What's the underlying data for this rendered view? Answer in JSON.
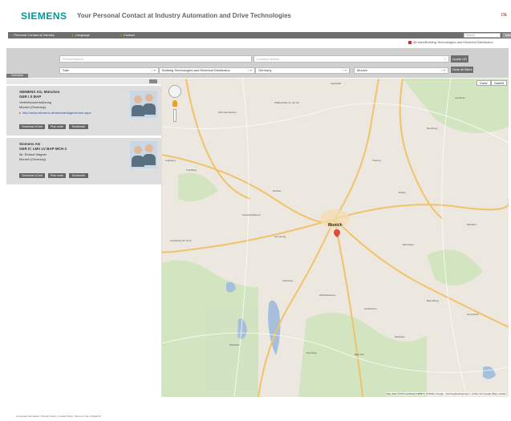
{
  "header": {
    "logo": "SIEMENS",
    "title": "Your Personal Contact at Industry Automation and Drive Technologies",
    "lang": "DE"
  },
  "nav": {
    "items": [
      "Personal Contact at Industry",
      "Language",
      "Contact"
    ],
    "search_placeholder": "Search",
    "search_button": "search"
  },
  "all_sites_label": "All sites/Building Technologies and Electrical Distribution",
  "filters": {
    "name_placeholder": "Person search",
    "location_placeholder": "Location search",
    "locate_button": "locate US",
    "clear_button": "Clear all filters",
    "selects": [
      "Sale",
      "Building Technologies and Electrical Distribution",
      "Germany",
      "Munich"
    ],
    "overview_tab": "Overview"
  },
  "results": [
    {
      "title": "SIEMENS AG, München",
      "dept": "GER I S BAP",
      "subtitle": "Vertriebsunterstützung",
      "city": "Munich (Germany)",
      "url": "http://www.siemens.de/alarmanlagen/index.aspx",
      "buttons": [
        "Download vCard",
        "Plan route",
        "Bookmark"
      ]
    },
    {
      "title": "Siemens AG",
      "dept": "GER IC LMV LV BAP MCH 3",
      "subtitle": "Mr. Roland Wagner",
      "city": "Munich (Germany)",
      "url": "",
      "buttons": [
        "Download vCard",
        "Plan route",
        "Bookmark"
      ]
    }
  ],
  "map": {
    "type_buttons": [
      "Karte",
      "Satellit"
    ],
    "city": "Munich",
    "labels": [
      "Schrobenhausen",
      "Pfaffenhofen an der Ilm",
      "Ingolstadt",
      "Landshut",
      "Freising",
      "Moosburg",
      "Augsburg",
      "Friedberg",
      "Dachau",
      "Erding",
      "Fürstenfeldbruck",
      "Germering",
      "Starnberg",
      "Wolfratshausen",
      "Rosenheim",
      "Holzkirchen",
      "Bad Aibling",
      "Weilheim",
      "Penzberg",
      "Bad Tölz",
      "Miesbach",
      "Ebersberg",
      "Mühldorf",
      "Landsberg am Lech"
    ],
    "copyright": "Map data ©2013 GeoBasis-DE/BKG (©2009), Google - Nutzungsbedingungen - Fehler bei Google Maps melden"
  },
  "footer": "Corporate Information | Privacy Policy | Cookie Policy | Terms of Use | Digital ID"
}
